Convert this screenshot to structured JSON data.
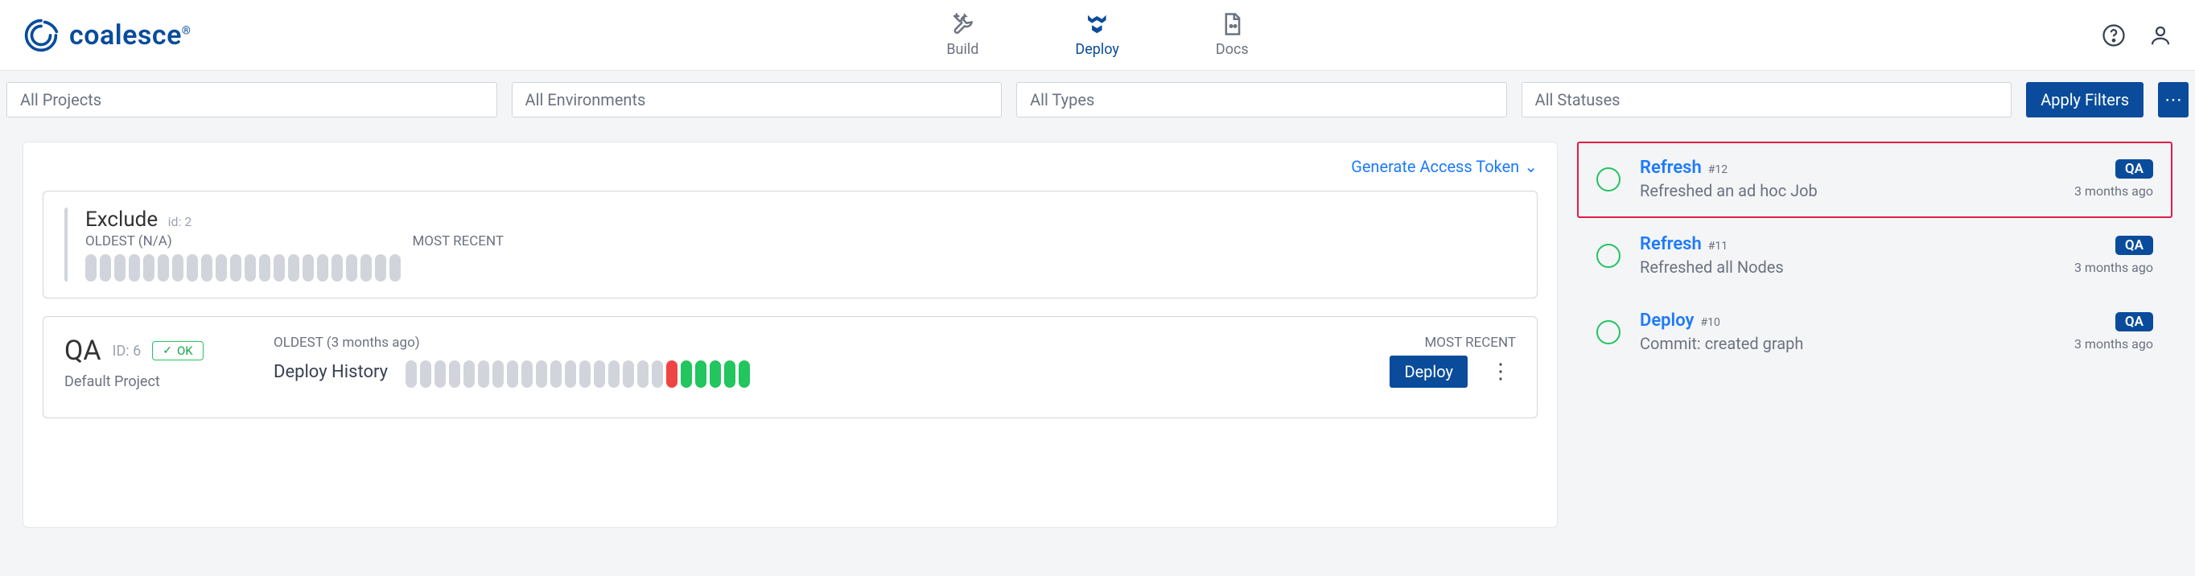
{
  "brand": {
    "name": "coalesce",
    "reg": "®"
  },
  "nav": {
    "build": "Build",
    "deploy": "Deploy",
    "docs": "Docs",
    "active": "deploy"
  },
  "filters": {
    "projects": "All Projects",
    "environments": "All Environments",
    "types": "All Types",
    "statuses": "All Statuses",
    "apply": "Apply Filters"
  },
  "token_link": "Generate Access Token",
  "exclude": {
    "title": "Exclude",
    "id_label": "id: 2",
    "oldest": "OLDEST (N/A)",
    "recent": "MOST RECENT",
    "pills": [
      "g",
      "g",
      "g",
      "g",
      "g",
      "g",
      "g",
      "g",
      "g",
      "g",
      "g",
      "g",
      "g",
      "g",
      "g",
      "g",
      "g",
      "g",
      "g",
      "g",
      "g",
      "g"
    ]
  },
  "qa": {
    "title": "QA",
    "id_label": "ID: 6",
    "ok": "OK",
    "sub": "Default Project",
    "hist_label": "Deploy History",
    "oldest": "OLDEST (3 months ago)",
    "recent": "MOST RECENT",
    "deploy_btn": "Deploy",
    "pills": [
      "g",
      "g",
      "g",
      "g",
      "g",
      "g",
      "g",
      "g",
      "g",
      "g",
      "g",
      "g",
      "g",
      "g",
      "g",
      "g",
      "g",
      "g",
      "r",
      "gr",
      "gr",
      "gr",
      "gr",
      "gr"
    ]
  },
  "runs": [
    {
      "title": "Refresh",
      "num": "#12",
      "desc": "Refreshed an ad hoc Job",
      "badge": "QA",
      "time": "3 months ago",
      "hl": true
    },
    {
      "title": "Refresh",
      "num": "#11",
      "desc": "Refreshed all Nodes",
      "badge": "QA",
      "time": "3 months ago",
      "hl": false
    },
    {
      "title": "Deploy",
      "num": "#10",
      "desc": "Commit: created graph",
      "badge": "QA",
      "time": "3 months ago",
      "hl": false
    }
  ]
}
